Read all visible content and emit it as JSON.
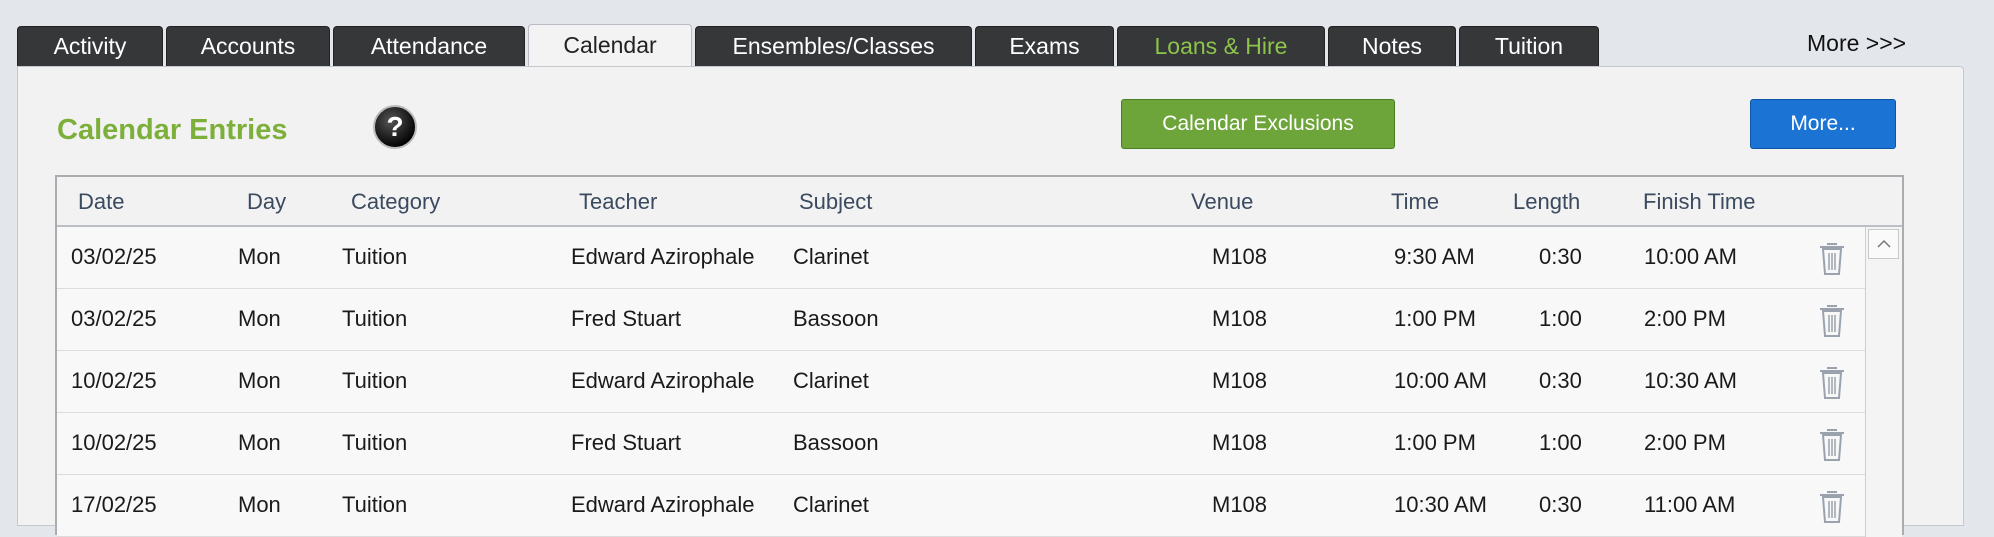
{
  "tabs": [
    {
      "label": "Activity",
      "active": false,
      "accent": false
    },
    {
      "label": "Accounts",
      "active": false,
      "accent": false
    },
    {
      "label": "Attendance",
      "active": false,
      "accent": false
    },
    {
      "label": "Calendar",
      "active": true,
      "accent": false
    },
    {
      "label": "Ensembles/Classes",
      "active": false,
      "accent": false
    },
    {
      "label": "Exams",
      "active": false,
      "accent": false
    },
    {
      "label": "Loans & Hire",
      "active": false,
      "accent": true
    },
    {
      "label": "Notes",
      "active": false,
      "accent": false
    },
    {
      "label": "Tuition",
      "active": false,
      "accent": false
    }
  ],
  "more_tabs_label": "More >>>",
  "page_title": "Calendar Entries",
  "buttons": {
    "exclusions_label": "Calendar Exclusions",
    "more_label": "More..."
  },
  "table": {
    "columns": [
      "Date",
      "Day",
      "Category",
      "Teacher",
      "Subject",
      "Venue",
      "Time",
      "Length",
      "Finish Time"
    ],
    "rows": [
      [
        "03/02/25",
        "Mon",
        "Tuition",
        "Edward Azirophale",
        "Clarinet",
        "M108",
        "9:30 AM",
        "0:30",
        "10:00 AM"
      ],
      [
        "03/02/25",
        "Mon",
        "Tuition",
        "Fred Stuart",
        "Bassoon",
        "M108",
        "1:00 PM",
        "1:00",
        "2:00 PM"
      ],
      [
        "10/02/25",
        "Mon",
        "Tuition",
        "Edward Azirophale",
        "Clarinet",
        "M108",
        "10:00 AM",
        "0:30",
        "10:30 AM"
      ],
      [
        "10/02/25",
        "Mon",
        "Tuition",
        "Fred Stuart",
        "Bassoon",
        "M108",
        "1:00 PM",
        "1:00",
        "2:00 PM"
      ],
      [
        "17/02/25",
        "Mon",
        "Tuition",
        "Edward Azirophale",
        "Clarinet",
        "M108",
        "10:30 AM",
        "0:30",
        "11:00 AM"
      ]
    ]
  },
  "icons": {
    "help": "help-icon",
    "delete": "trash-icon",
    "scroll_up": "chevron-up-icon"
  },
  "colors": {
    "title_green": "#7db03a",
    "tab_dark": "#363739",
    "button_green": "#6ea53a",
    "button_blue": "#1b74d3"
  }
}
